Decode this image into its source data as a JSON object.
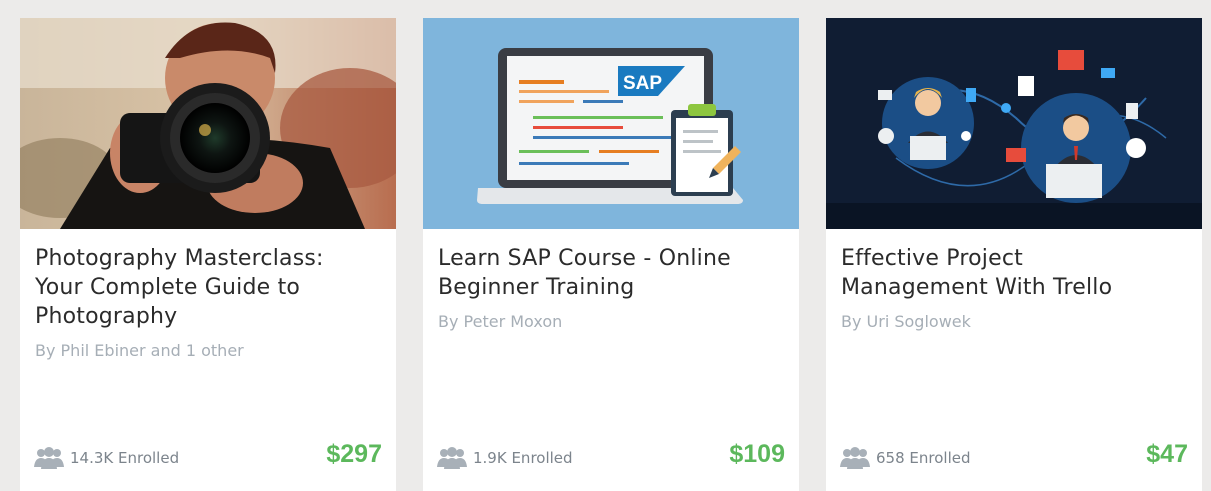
{
  "courses": [
    {
      "title_lines": [
        "Photography Masterclass:",
        "Your Complete Guide to",
        "Photography"
      ],
      "author": "By Phil Ebiner and 1 other",
      "enrolled": "14.3K Enrolled",
      "price": "$297",
      "thumbnail_icon": "camera-photographer-image"
    },
    {
      "title_lines": [
        "Learn SAP Course - Online",
        "Beginner Training"
      ],
      "author": "By Peter Moxon",
      "enrolled": "1.9K Enrolled",
      "price": "$109",
      "thumbnail_icon": "laptop-sap-clipboard-image",
      "thumbnail_text": "SAP"
    },
    {
      "title_lines": [
        "Effective Project",
        "Management With Trello"
      ],
      "author": "By Uri Soglowek",
      "enrolled": "658 Enrolled",
      "price": "$47",
      "thumbnail_icon": "team-network-illustration"
    }
  ],
  "colors": {
    "price": "#5cb85c",
    "author": "#a6aeb6",
    "enrolled": "#7c848c",
    "background": "#ecebea"
  }
}
